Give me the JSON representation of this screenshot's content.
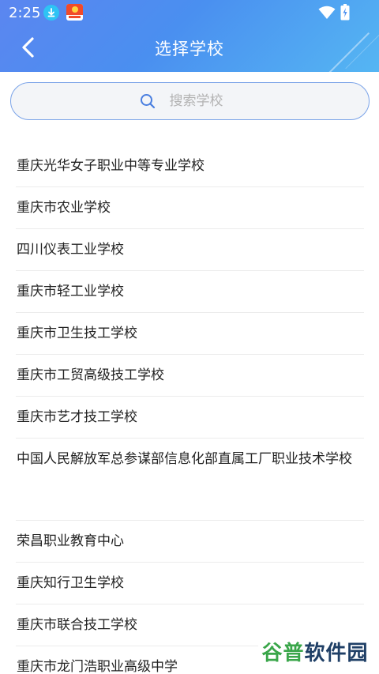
{
  "status_bar": {
    "time": "2:25",
    "icons": [
      "download-icon",
      "app-icon",
      "wifi-icon",
      "battery-icon"
    ]
  },
  "header": {
    "title": "选择学校",
    "back_icon": "chevron-left-icon",
    "gradient_start": "#5b86f0",
    "gradient_end": "#55b6f3"
  },
  "search": {
    "placeholder": "搜索学校",
    "value": "",
    "icon": "search-icon",
    "border_color": "#7aa3e8"
  },
  "schools": [
    "重庆光华女子职业中等专业学校",
    "重庆市农业学校",
    "四川仪表工业学校",
    "重庆市轻工业学校",
    "重庆市卫生技工学校",
    "重庆市工贸高级技工学校",
    "重庆市艺才技工学校",
    "中国人民解放军总参谋部信息化部直属工厂职业技术学校",
    "荣昌职业教育中心",
    "重庆知行卫生学校",
    "重庆市联合技工学校",
    "重庆市龙门浩职业高级中学"
  ],
  "watermark": {
    "part1": "谷普",
    "part2": "软件园"
  }
}
